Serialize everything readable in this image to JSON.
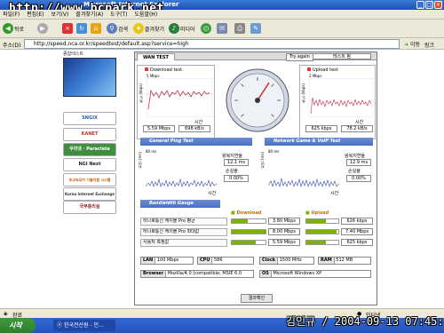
{
  "window": {
    "title": "Microsoft Internet Explorer",
    "watermark": "http://www.bcpark.net"
  },
  "menubar": {
    "items": [
      "파일(F)",
      "편집(E)",
      "보기(V)",
      "즐겨찾기(A)",
      "도구(T)",
      "도움말(H)"
    ]
  },
  "toolbar": {
    "back": "뒤로",
    "search": "검색",
    "favorites": "즐겨찾기",
    "media": "미디어"
  },
  "address": {
    "label": "주소(D)",
    "url": "http://speed.nca.or.kr/speedtest/default.asp?service=high",
    "go": "이동",
    "links": "링크"
  },
  "nav": {
    "header": "종합테스트",
    "items": [
      "SNGIX",
      "KANET",
      "우리넷 · Paraclete",
      "NGI Next Generation",
      "초고속국가 기술지원 시스템",
      "Korea Internet Exchange",
      "국무총리실"
    ]
  },
  "wan": {
    "tab": "WAN TEST",
    "try_again": "Try again",
    "test_name": "테스트 됨",
    "download": {
      "title": "Download test",
      "scale": "5 Mbps",
      "time_label": "시간",
      "speed_kbps": "5.59 Mbps",
      "kbs": "698 kB/s",
      "ylabel": "속도 (kbps)"
    },
    "upload": {
      "title": "Upload test",
      "scale": "2 Mbps",
      "time_label": "시간",
      "speed_kbps": "625 kbps",
      "kbs": "78.2 kB/s",
      "ylabel": "속도 (kbps)"
    },
    "general_ping": {
      "title": "General Ping Test",
      "scale": "80 ms",
      "time_label": "시간",
      "latency_label": "왕복지연율",
      "latency": "12.1 ms",
      "loss_label": "손실율",
      "loss": "0.00%",
      "ylabel": "지연 (ms)"
    },
    "network_game": {
      "title": "Network Game & VoIP Test",
      "scale": "80 ms",
      "time_label": "시간",
      "latency_label": "왕복지연율",
      "latency": "12.9 ms",
      "loss_label": "손실율",
      "loss": "0.00%",
      "ylabel": "지연 (ms)"
    },
    "gauge": {
      "title": "Bandwidth Gauge",
      "download_label": "Download",
      "upload_label": "Upload",
      "rows": [
        {
          "label": "하나로통신 케이블 Pro 평균",
          "down": "3.80 Mbps",
          "down_frac": 0.48,
          "up": "626 kbps",
          "up_frac": 0.6
        },
        {
          "label": "하나로통신 케이블 Pro 최대값",
          "down": "8.00 Mbps",
          "down_frac": 1.0,
          "up": "7.40 Mbps",
          "up_frac": 0.95
        },
        {
          "label": "사용자 측정값",
          "down": "5.59 Mbps",
          "down_frac": 0.7,
          "up": "625 kbps",
          "up_frac": 0.6
        }
      ]
    },
    "sysinfo": {
      "lan_label": "LAN",
      "lan": "100 Mbps",
      "cpu_label": "CPU",
      "cpu": "586",
      "clock_label": "Clock",
      "clock": "1500 MHz",
      "ram_label": "RAM",
      "ram": "512 MB",
      "browser_label": "Browser",
      "browser": "Mozilla/4.0 (compatible; MSIE 6.0",
      "os_label": "OS",
      "os": "Microsoft Windows XP"
    },
    "confirm": "결과확인"
  },
  "statusbar": {
    "left": "완료",
    "right": "인터넷"
  },
  "taskbar": {
    "start": "시작",
    "item": "한국전산원 - 인..."
  },
  "stamp": "김인규 / 2004-09-13 07:45:17"
}
